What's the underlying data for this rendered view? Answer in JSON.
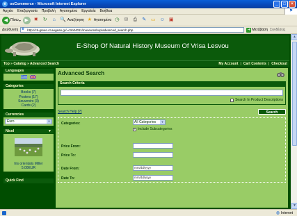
{
  "window": {
    "title": "osCommerce - Microsoft Internet Explorer"
  },
  "menu": [
    "Αρχείο",
    "Επεξεργασία",
    "Προβολή",
    "Αγαπημένα",
    "Εργαλεία",
    "Βοήθεια"
  ],
  "toolbar": {
    "back_label": "Πίσω",
    "search_label": "Αναζήτηση",
    "favorites_label": "Αγαπημένα"
  },
  "address": {
    "label": "Διεύθυνση",
    "url": "http://cti-green.ct.aegean.gr/~ctm04011/museumshop/advanced_search.php",
    "go_label": "Μετάβαση",
    "links_label": "Συνδέσεις"
  },
  "site": {
    "name": "E-Shop Of Natural History Museum Of Vrisa Lesvou",
    "breadcrumb": "Top » Catalog » Advanced Search",
    "nav": [
      "My Account",
      "Cart Contents",
      "Checkout"
    ]
  },
  "sidebar": {
    "languages_title": "Languages",
    "categories_title": "Categories",
    "categories": [
      "Books (7)",
      "Posters (17)",
      "Souvenirs (3)",
      "Cards (2)"
    ],
    "currencies_title": "Currencies",
    "currency_selected": "Euro",
    "product_box_title": "Nicol",
    "product_name": "Iris orientalis Miller",
    "product_price": "5.00EUR",
    "quickfind_title": "Quick Find"
  },
  "main": {
    "title": "Advanced Search",
    "criteria_title": "Search Criteria",
    "search_value": "",
    "in_descriptions_label": "Search In Product Descriptions",
    "help_label": "Search Help [?]",
    "search_button": "Search",
    "categories_label": "Categories:",
    "categories_selected": "All Categories",
    "subcat_label": "Include Subcategories",
    "price_from_label": "Price From:",
    "price_to_label": "Price To:",
    "date_from_label": "Date From:",
    "date_to_label": "Date To:",
    "date_placeholder": "mm/dd/yyyy"
  },
  "status": {
    "zone": "Internet"
  },
  "colors": {
    "page_bg": "#004d00",
    "panel": "#99cc66",
    "header_text": "#ffffcc"
  }
}
